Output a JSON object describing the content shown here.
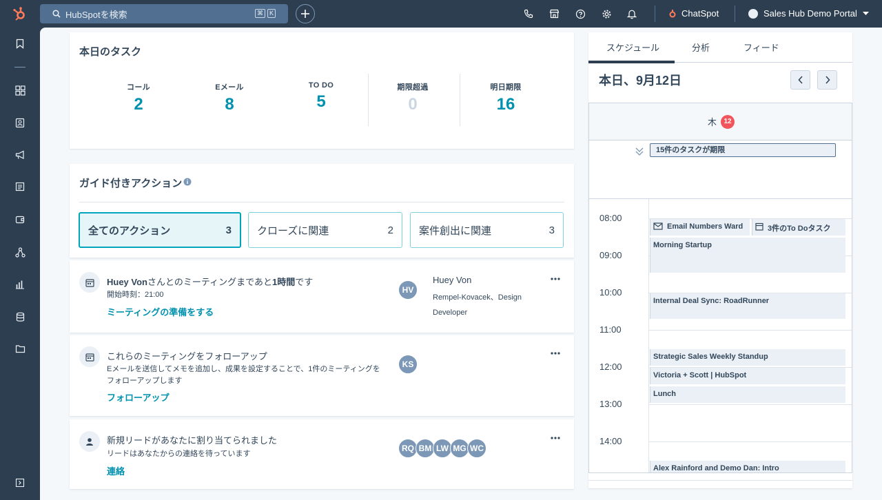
{
  "topbar": {
    "search_placeholder": "HubSpotを検索",
    "kbd_cmd": "⌘",
    "kbd_k": "K",
    "chatspot_label": "ChatSpot",
    "portal_label": "Sales Hub Demo Portal"
  },
  "tasks": {
    "title": "本日のタスク",
    "stats": [
      {
        "label": "コール",
        "value": "2"
      },
      {
        "label": "Eメール",
        "value": "8"
      },
      {
        "label": "TO DO",
        "value": "5"
      },
      {
        "label": "期限超過",
        "value": "0"
      },
      {
        "label": "明日期限",
        "value": "16"
      }
    ]
  },
  "guided": {
    "title": "ガイド付きアクション",
    "filters": [
      {
        "label": "全てのアクション",
        "count": "3"
      },
      {
        "label": "クローズに関連",
        "count": "2"
      },
      {
        "label": "案件創出に関連",
        "count": "3"
      }
    ]
  },
  "actions": [
    {
      "title_name": "Huey Von",
      "title_mid": "さんとのミーティングまであと",
      "title_bold2": "1時間",
      "title_end": "です",
      "sub": "開始時刻：21:00",
      "link": "ミーティングの準備をする",
      "avatar": "HV",
      "contact_name": "Huey Von",
      "contact_company": "Rempel-Kovacek、Design Developer"
    },
    {
      "title": "これらのミーティングをフォローアップ",
      "sub": "Eメールを送信してメモを追加し、成果を設定することで、1件のミーティングをフォローアップします",
      "link": "フォローアップ",
      "avatar": "KS"
    },
    {
      "title": "新規リードがあなたに割り当てられました",
      "sub": "リードはあなたからの連絡を待っています",
      "link": "連絡",
      "avatars": [
        "RQ",
        "BM",
        "LW",
        "MG",
        "WC"
      ]
    }
  ],
  "schedule": {
    "tabs": [
      "スケジュール",
      "分析",
      "フィード"
    ],
    "date": "本日、9月12日",
    "day_label": "木",
    "day_number": "12",
    "due_banner": "15件のタスクが期限",
    "times": [
      "08:00",
      "09:00",
      "10:00",
      "11:00",
      "12:00",
      "13:00",
      "14:00"
    ],
    "events": [
      {
        "label": "Email Numbers Ward",
        "icon": "mail-icon"
      },
      {
        "label": "3件のTo Doタスク",
        "icon": "calendar-icon"
      },
      {
        "label": "Morning Startup"
      },
      {
        "label": "Internal Deal Sync: RoadRunner"
      },
      {
        "label": "Strategic Sales Weekly Standup"
      },
      {
        "label": "Victoria + Scott | HubSpot"
      },
      {
        "label": "Lunch"
      },
      {
        "label": "Alex Rainford and Demo Dan: Intro"
      }
    ]
  },
  "colors": {
    "nav": "#2d3e50",
    "accent": "#0091ae",
    "badge": "#f2545b",
    "brand": "#ff7a59"
  }
}
